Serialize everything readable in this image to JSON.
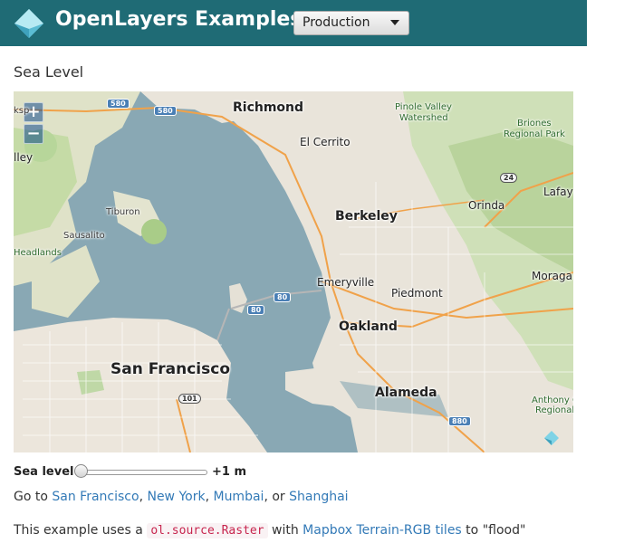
{
  "header": {
    "brand": "OpenLayers Examples",
    "version_select": "Production",
    "background_color": "#1f6b75"
  },
  "page": {
    "title": "Sea Level"
  },
  "map": {
    "zoom_in": "+",
    "zoom_out": "−",
    "labels": {
      "richmond": "Richmond",
      "el_cerrito": "El Cerrito",
      "berkeley": "Berkeley",
      "orinda": "Orinda",
      "lafay": "Lafay",
      "moraga": "Moraga",
      "emeryville": "Emeryville",
      "piedmont": "Piedmont",
      "oakland": "Oakland",
      "alameda": "Alameda",
      "san_francisco": "San Francisco",
      "tiburon": "Tiburon",
      "sausalito": "Sausalito",
      "headlands": "Headlands",
      "ksp": "ksp",
      "lley": "lley",
      "pinole_valley_watershed_1": "Pinole Valley",
      "pinole_valley_watershed_2": "Watershed",
      "briones_1": "Briones",
      "briones_2": "Regional Park",
      "anthony_1": "Anthony C",
      "anthony_2": "Regional"
    },
    "shields": {
      "i580": "580",
      "i580b": "580",
      "r24": "24",
      "i80": "80",
      "i80b": "80",
      "us101": "101",
      "i880": "880"
    }
  },
  "controls": {
    "slider_label": "Sea level",
    "slider_value": 0,
    "slider_max_label": "+1 m"
  },
  "goto": {
    "prefix": "Go to ",
    "sf": "San Francisco",
    "sep1": ", ",
    "ny": "New York",
    "sep2": ", ",
    "mumbai": "Mumbai",
    "sep3": ", or ",
    "shanghai": "Shanghai"
  },
  "description": {
    "part1": "This example uses a ",
    "code": "ol.source.Raster",
    "part2": " with ",
    "link": "Mapbox Terrain-RGB tiles",
    "part3": " to \"flood\""
  }
}
